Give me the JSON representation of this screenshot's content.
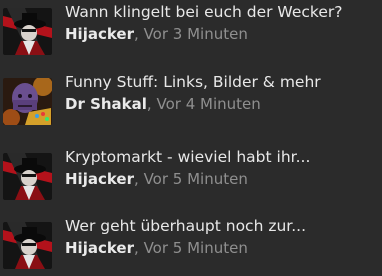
{
  "threads": [
    {
      "title": "Wann klingelt bei euch der Wecker?",
      "author": "Hijacker",
      "separator": ",",
      "time": "Vor 3 Minuten",
      "avatar": "hijacker-avatar-icon"
    },
    {
      "title": "Funny Stuff: Links, Bilder & mehr",
      "author": "Dr Shakal",
      "separator": ",",
      "time": "Vor 4 Minuten",
      "avatar": "thanos-avatar-icon"
    },
    {
      "title": "Kryptomarkt - wieviel habt ihr...",
      "author": "Hijacker",
      "separator": ",",
      "time": "Vor 5 Minuten",
      "avatar": "hijacker-avatar-icon"
    },
    {
      "title": "Wer geht überhaupt noch zur...",
      "author": "Hijacker",
      "separator": ",",
      "time": "Vor 5 Minuten",
      "avatar": "hijacker-avatar-icon"
    }
  ],
  "colors": {
    "background": "#2b2b2b",
    "title": "#e8e8e8",
    "author": "#eaeaea",
    "meta": "#8f8f8f"
  }
}
